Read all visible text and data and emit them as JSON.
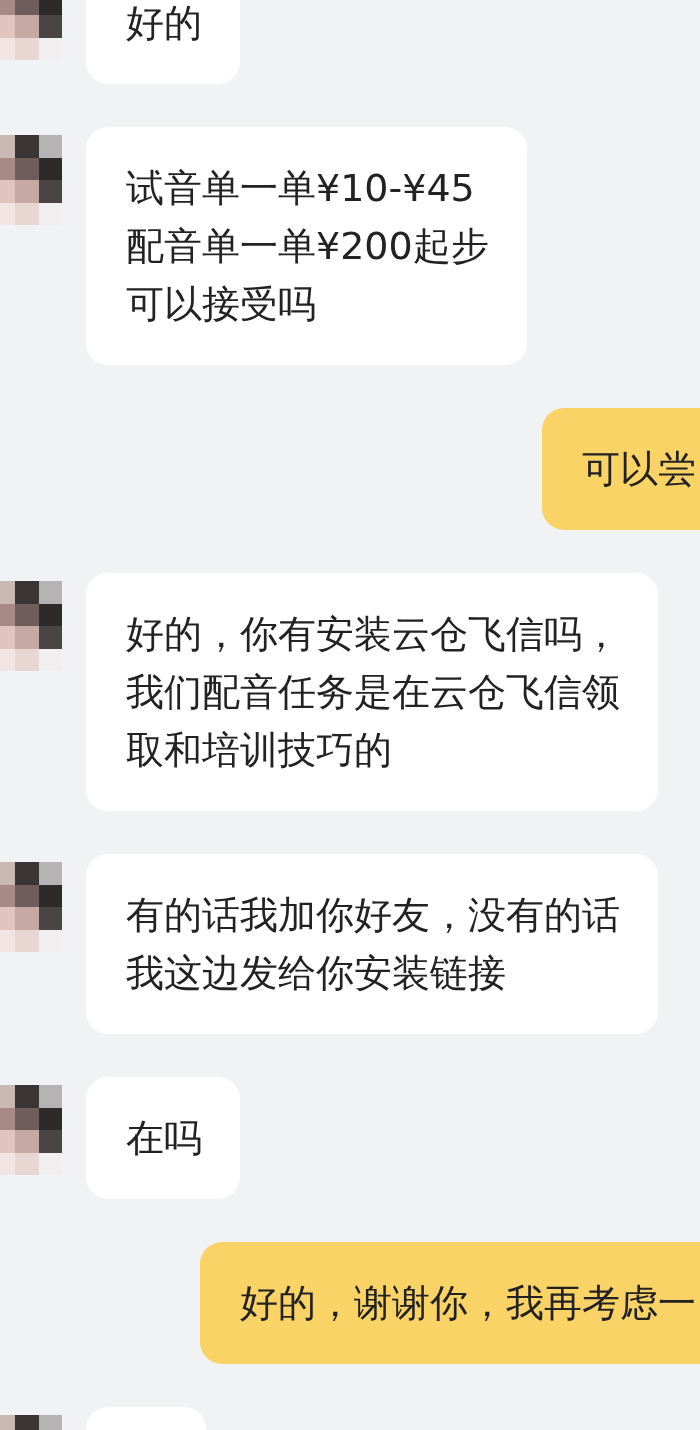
{
  "messages": [
    {
      "kind": "incoming",
      "lines": [
        "好的"
      ]
    },
    {
      "kind": "incoming",
      "lines": [
        "试音单一单¥10-¥45",
        "配音单一单¥200起步",
        "可以接受吗"
      ]
    },
    {
      "kind": "outgoing",
      "lines": [
        "可以尝"
      ]
    },
    {
      "kind": "incoming",
      "lines": [
        "好的，你有安装云仓飞信吗，",
        "我们配音任务是在云仓飞信领",
        "取和培训技巧的"
      ]
    },
    {
      "kind": "incoming",
      "lines": [
        "有的话我加你好友，没有的话",
        "我这边发给你安装链接"
      ]
    },
    {
      "kind": "incoming",
      "lines": [
        "在吗"
      ]
    },
    {
      "kind": "outgoing",
      "lines": [
        "好的，谢谢你，我再考虑一"
      ]
    },
    {
      "kind": "incoming"
    }
  ]
}
